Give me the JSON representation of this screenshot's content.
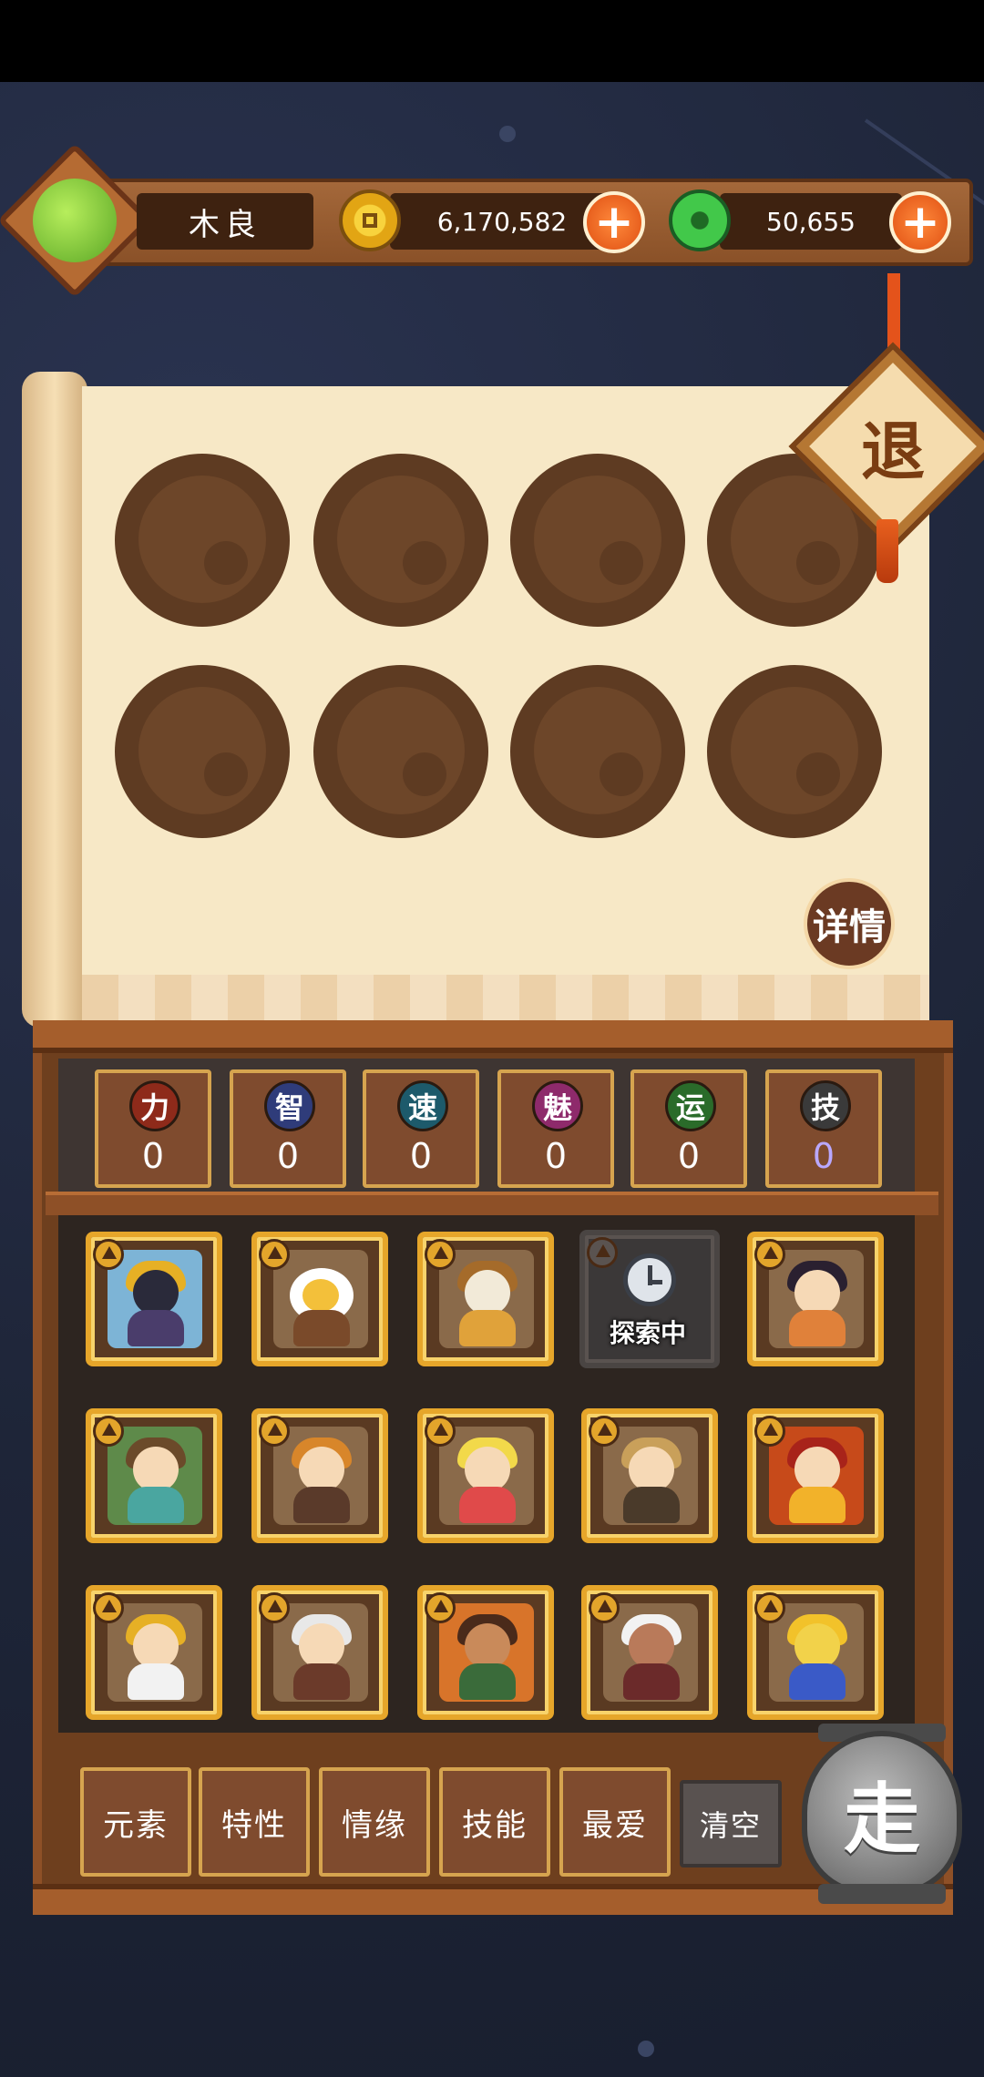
{
  "header": {
    "player_name": "木良",
    "gold": "6,170,582",
    "jade": "50,655",
    "plus_symbol": "+",
    "icons": {
      "gold": "coin-icon",
      "jade": "jade-icon",
      "add": "plus-icon"
    }
  },
  "back_button": {
    "label": "退"
  },
  "detail_button": {
    "label": "详情"
  },
  "slots_count": 8,
  "stats": [
    {
      "icon": "力",
      "value": "0",
      "color": "#8e2a1a"
    },
    {
      "icon": "智",
      "value": "0",
      "color": "#2f3c7a"
    },
    {
      "icon": "速",
      "value": "0",
      "color": "#1d5a6b"
    },
    {
      "icon": "魅",
      "value": "0",
      "color": "#8e2a6b"
    },
    {
      "icon": "运",
      "value": "0",
      "color": "#2a6b2a"
    },
    {
      "icon": "技",
      "value": "0",
      "color": "#3a3a3a"
    }
  ],
  "heroes": [
    {
      "state": "normal"
    },
    {
      "state": "normal"
    },
    {
      "state": "normal"
    },
    {
      "state": "exploring",
      "label": "探索中"
    },
    {
      "state": "normal"
    },
    {
      "state": "normal"
    },
    {
      "state": "normal"
    },
    {
      "state": "normal"
    },
    {
      "state": "normal"
    },
    {
      "state": "normal"
    },
    {
      "state": "normal"
    },
    {
      "state": "normal"
    },
    {
      "state": "normal"
    },
    {
      "state": "normal"
    },
    {
      "state": "normal"
    }
  ],
  "filters": {
    "element": "元素",
    "trait": "特性",
    "bond": "情缘",
    "skill": "技能",
    "favorite": "最爱",
    "clear": "清空"
  },
  "go_button": {
    "label": "走"
  }
}
